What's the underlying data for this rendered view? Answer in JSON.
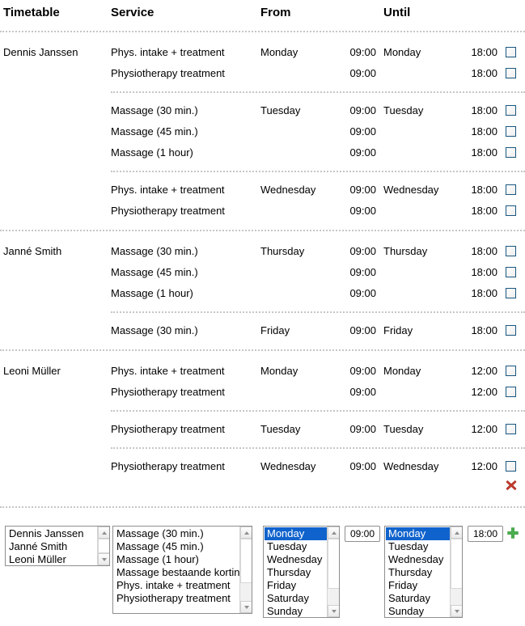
{
  "columns": {
    "timetable": "Timetable",
    "service": "Service",
    "from": "From",
    "until": "Until"
  },
  "colors": {
    "separator": "#c6c6c6",
    "checkbox_border": "#18567f",
    "selection": "#1063cc",
    "delete_icon": "#c0392b",
    "add_icon": "#4caf50"
  },
  "icons": {
    "delete": "delete-icon",
    "add": "add-icon",
    "checkbox": "checkbox"
  },
  "persons": [
    {
      "name": "Dennis Janssen",
      "groups": [
        {
          "from_day": "Monday",
          "until_day": "Monday",
          "rows": [
            {
              "service": "Phys. intake + treatment",
              "from_day": "Monday",
              "from_time": "09:00",
              "until_day": "Monday",
              "until_time": "18:00",
              "checked": false
            },
            {
              "service": "Physiotherapy treatment",
              "from_day": "",
              "from_time": "09:00",
              "until_day": "",
              "until_time": "18:00",
              "checked": false
            }
          ]
        },
        {
          "from_day": "Tuesday",
          "until_day": "Tuesday",
          "rows": [
            {
              "service": "Massage (30 min.)",
              "from_day": "Tuesday",
              "from_time": "09:00",
              "until_day": "Tuesday",
              "until_time": "18:00",
              "checked": false
            },
            {
              "service": "Massage (45 min.)",
              "from_day": "",
              "from_time": "09:00",
              "until_day": "",
              "until_time": "18:00",
              "checked": false
            },
            {
              "service": "Massage (1 hour)",
              "from_day": "",
              "from_time": "09:00",
              "until_day": "",
              "until_time": "18:00",
              "checked": false
            }
          ]
        },
        {
          "from_day": "Wednesday",
          "until_day": "Wednesday",
          "rows": [
            {
              "service": "Phys. intake + treatment",
              "from_day": "Wednesday",
              "from_time": "09:00",
              "until_day": "Wednesday",
              "until_time": "18:00",
              "checked": false
            },
            {
              "service": "Physiotherapy treatment",
              "from_day": "",
              "from_time": "09:00",
              "until_day": "",
              "until_time": "18:00",
              "checked": false
            }
          ]
        }
      ]
    },
    {
      "name": "Janné Smith",
      "groups": [
        {
          "from_day": "Thursday",
          "until_day": "Thursday",
          "rows": [
            {
              "service": "Massage (30 min.)",
              "from_day": "Thursday",
              "from_time": "09:00",
              "until_day": "Thursday",
              "until_time": "18:00",
              "checked": false
            },
            {
              "service": "Massage (45 min.)",
              "from_day": "",
              "from_time": "09:00",
              "until_day": "",
              "until_time": "18:00",
              "checked": false
            },
            {
              "service": "Massage (1 hour)",
              "from_day": "",
              "from_time": "09:00",
              "until_day": "",
              "until_time": "18:00",
              "checked": false
            }
          ]
        },
        {
          "from_day": "Friday",
          "until_day": "Friday",
          "rows": [
            {
              "service": "Massage (30 min.)",
              "from_day": "Friday",
              "from_time": "09:00",
              "until_day": "Friday",
              "until_time": "18:00",
              "checked": false
            }
          ]
        }
      ]
    },
    {
      "name": "Leoni Müller",
      "groups": [
        {
          "from_day": "Monday",
          "until_day": "Monday",
          "rows": [
            {
              "service": "Phys. intake + treatment",
              "from_day": "Monday",
              "from_time": "09:00",
              "until_day": "Monday",
              "until_time": "12:00",
              "checked": false
            },
            {
              "service": "Physiotherapy treatment",
              "from_day": "",
              "from_time": "09:00",
              "until_day": "",
              "until_time": "12:00",
              "checked": false
            }
          ]
        },
        {
          "from_day": "Tuesday",
          "until_day": "Tuesday",
          "rows": [
            {
              "service": "Physiotherapy treatment",
              "from_day": "Tuesday",
              "from_time": "09:00",
              "until_day": "Tuesday",
              "until_time": "12:00",
              "checked": false
            }
          ]
        },
        {
          "from_day": "Wednesday",
          "until_day": "Wednesday",
          "rows": [
            {
              "service": "Physiotherapy treatment",
              "from_day": "Wednesday",
              "from_time": "09:00",
              "until_day": "Wednesday",
              "until_time": "12:00",
              "checked": false
            }
          ]
        }
      ],
      "has_delete": true
    }
  ],
  "form": {
    "person_list": {
      "options": [
        "Dennis Janssen",
        "Janné Smith",
        "Leoni Müller"
      ],
      "selected": null
    },
    "service_list": {
      "options": [
        "Massage (30 min.)",
        "Massage (45 min.)",
        "Massage (1 hour)",
        "Massage bestaande kortin",
        "Phys. intake + treatment",
        "Physiotherapy treatment"
      ],
      "selected": null
    },
    "from_day_list": {
      "options": [
        "Monday",
        "Tuesday",
        "Wednesday",
        "Thursday",
        "Friday",
        "Saturday",
        "Sunday"
      ],
      "selected": "Monday"
    },
    "from_time": {
      "value": "09:00"
    },
    "until_day_list": {
      "options": [
        "Monday",
        "Tuesday",
        "Wednesday",
        "Thursday",
        "Friday",
        "Saturday",
        "Sunday"
      ],
      "selected": "Monday"
    },
    "until_time": {
      "value": "18:00"
    }
  }
}
